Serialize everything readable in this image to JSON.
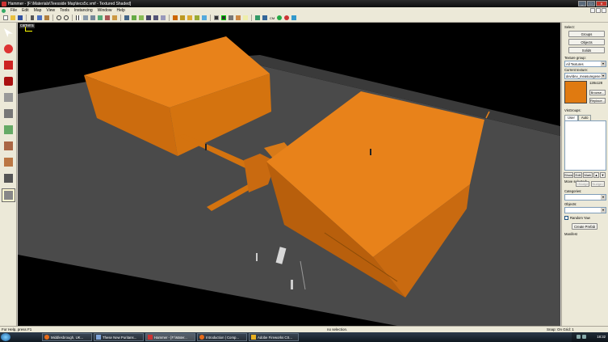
{
  "window": {
    "title": "Hammer - [F:\\Materials\\Teesside Map\\tecs5c.vmf - Textured Shaded]",
    "controls": [
      "_",
      "□",
      "✕"
    ]
  },
  "menu": [
    "File",
    "Edit",
    "Map",
    "View",
    "Tools",
    "Instancing",
    "Window",
    "Help"
  ],
  "toolbar": {
    "cm_label": "CM"
  },
  "viewport": {
    "camera_label": "camera"
  },
  "right_panel": {
    "select_label": "Select:",
    "groups_btn": "Groups",
    "objects_btn": "Objects",
    "solids_btn": "Solids",
    "texture_group_label": "Texture group:",
    "texture_group_value": "All Textures",
    "current_texture_label": "Current texture:",
    "current_texture_value": "dev/dev_measuregene",
    "texture_size": "128x128",
    "browse_btn": "Browse...",
    "replace_btn": "Replace...",
    "visgroups_label": "VisGroups:",
    "tab_user": "User",
    "tab_auto": "Auto",
    "show_btn": "Show",
    "edit_btn": "Edit",
    "mark_btn": "Mark",
    "move_selected_label": "Move selected:",
    "nudge_left": "<Nudge",
    "nudge_right": "Nudge>",
    "categories_label": "Categories:",
    "objects_label": "Objects:",
    "random_yaw_label": "Random Yaw",
    "create_prefab_btn": "Create Prefab",
    "manifest_label": "Manifest"
  },
  "status": {
    "help": "For Help, press F1",
    "selection": "no selection.",
    "snap": "Snap: On Grid: 1"
  },
  "taskbar": {
    "items": [
      "Middlesbrough, UK...",
      "These New Puritans...",
      "Hammer - [F:\\Mater...",
      "Introduction | Comp...",
      "Adobe Fireworks CS..."
    ],
    "clock": "18:32"
  },
  "colors": {
    "brush": "#e07a10",
    "ground": "#4a4a4a",
    "viewport_bg": "#000000",
    "selection_yellow": "#ffff00"
  }
}
